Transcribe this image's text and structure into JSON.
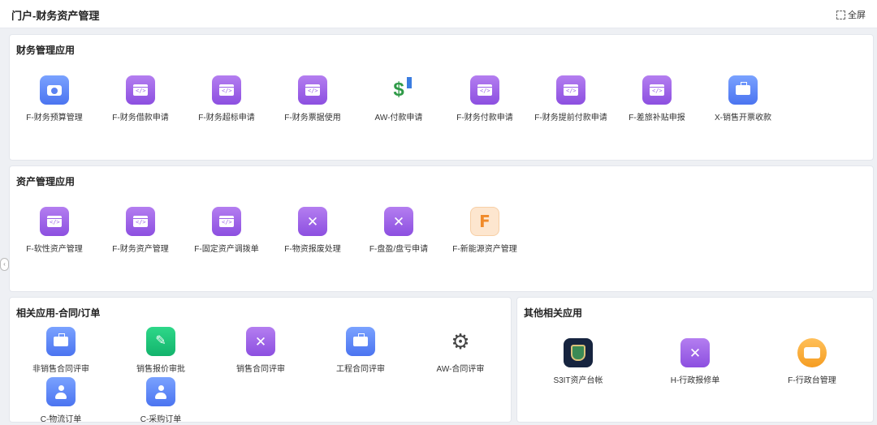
{
  "header": {
    "title": "门户-财务资产管理",
    "fullscreen_label": "全屏"
  },
  "sections": {
    "finance": {
      "title": "财务管理应用",
      "apps": [
        {
          "label": "F-财务预算管理",
          "icon": "camera-icon"
        },
        {
          "label": "F-财务借款申请",
          "icon": "window-code-icon"
        },
        {
          "label": "F-财务超标申请",
          "icon": "window-code-icon"
        },
        {
          "label": "F-财务票据使用",
          "icon": "window-code-icon"
        },
        {
          "label": "AW-付款申请",
          "icon": "money-upload-icon"
        },
        {
          "label": "F-财务付款申请",
          "icon": "window-code-icon"
        },
        {
          "label": "F-财务提前付款申请",
          "icon": "window-code-icon"
        },
        {
          "label": "F-差旅补贴申报",
          "icon": "window-code-icon"
        },
        {
          "label": "X-销售开票收款",
          "icon": "briefcase-icon"
        }
      ]
    },
    "asset": {
      "title": "资产管理应用",
      "apps": [
        {
          "label": "F-软性资产管理",
          "icon": "window-code-icon"
        },
        {
          "label": "F-财务资产管理",
          "icon": "window-code-icon"
        },
        {
          "label": "F-固定资产调拨单",
          "icon": "window-code-icon"
        },
        {
          "label": "F-物资报废处理",
          "icon": "tools-icon"
        },
        {
          "label": "F-盘盈/盘亏申请",
          "icon": "tools-icon"
        },
        {
          "label": "F-新能源资产管理",
          "icon": "letter-f-icon",
          "letter": "F"
        }
      ]
    },
    "contract": {
      "title": "相关应用-合同/订单",
      "apps": [
        {
          "label": "非销售合同评审",
          "icon": "briefcase-icon"
        },
        {
          "label": "销售报价审批",
          "icon": "pen-icon"
        },
        {
          "label": "销售合同评审",
          "icon": "tools-icon"
        },
        {
          "label": "工程合同评审",
          "icon": "briefcase-icon"
        },
        {
          "label": "AW-合同评审",
          "icon": "gear-document-icon"
        },
        {
          "label": "C-物流订单",
          "icon": "user-icon"
        },
        {
          "label": "C-采购订单",
          "icon": "user-icon"
        }
      ]
    },
    "other": {
      "title": "其他相关应用",
      "apps": [
        {
          "label": "S3IT资产台帐",
          "icon": "shield-icon"
        },
        {
          "label": "H-行政报修单",
          "icon": "tools-icon"
        },
        {
          "label": "F-行政台管理",
          "icon": "card-icon"
        }
      ]
    }
  },
  "colors": {
    "purple": "#9b63e6",
    "blue": "#5b82f2",
    "green": "#1fc57a",
    "orange": "#f7a531",
    "navy": "#16243f"
  }
}
